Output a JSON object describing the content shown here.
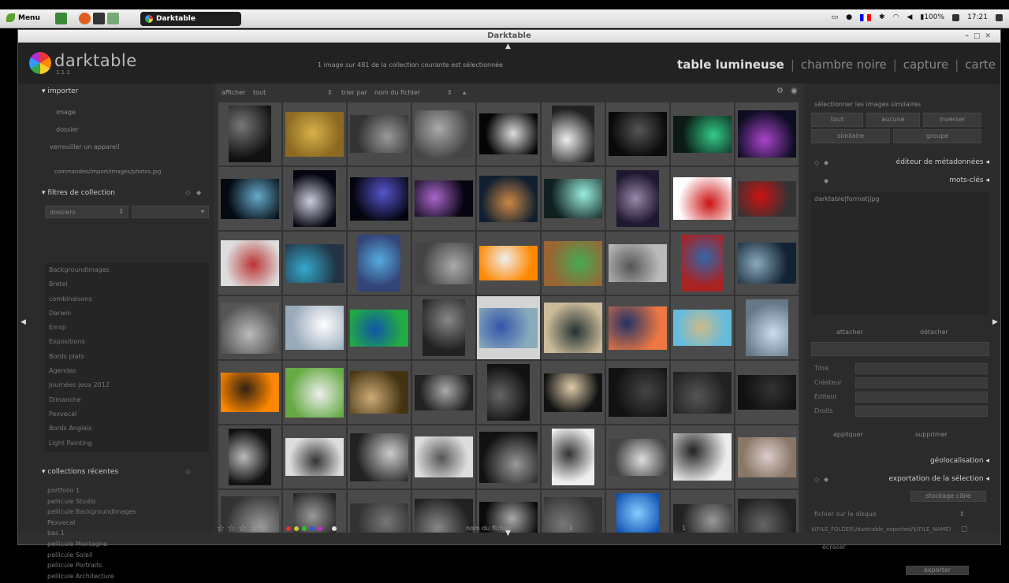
{
  "taskbar": {
    "menu_label": "Menu",
    "task_title": "Darktable",
    "battery": "100%",
    "clock": "17:21"
  },
  "window": {
    "title": "Darktable"
  },
  "app": {
    "logo_name": "darktable",
    "logo_version": "1.1.1",
    "collection_info": "1 image sur 481 de la collection courante est sélectionnée",
    "views": [
      "table lumineuse",
      "chambre noire",
      "capture",
      "carte"
    ],
    "active_view": "table lumineuse"
  },
  "left": {
    "importer": "importer",
    "import_items": [
      "image",
      "dossier",
      "verrouiller un appareil"
    ],
    "import_detail": "commandes/import/images/photos.jpg",
    "filters_header": "filtres de collection",
    "filter_select": "dossiers",
    "filter_list": [
      "BackgroundImages",
      "Bretel",
      "combinaisons",
      "Darwin",
      "Emoji",
      "Expositions",
      "Bords plats",
      "Agendas",
      "Journées jeux 2012",
      "Dimanche",
      "Pexvecal",
      "Bords Anglais",
      "Light Painting"
    ],
    "recent_header": "collections récentes",
    "recent_list": [
      "portfolio 1",
      "pellicule Studio",
      "pellicule BackgroundImages",
      "Pexvecal",
      "bas 1",
      "pellicule Montagne",
      "pellicule Soleil",
      "pellicule Portraits",
      "pellicule Architecture"
    ]
  },
  "center": {
    "show_label": "afficher",
    "show_value": "tout",
    "sort_label": "trier par",
    "sort_value": "nom du fichier",
    "bottom_select": "nom du fichier",
    "bottom_right": "1"
  },
  "right": {
    "top_label": "sélectionner les images similaires",
    "buttons_row1": [
      "tout",
      "aucune",
      "inverser"
    ],
    "buttons_row2": [
      "similaire",
      "groupe"
    ],
    "metadata_editor": "éditeur de métadonnées",
    "tags": "mots-clés",
    "tag_entry": "darktable|format|jpg",
    "attach": "attacher",
    "detach": "détacher",
    "fields": [
      "Titre",
      "Créateur",
      "Éditeur",
      "Droits"
    ],
    "apply": "appliquer",
    "delete": "supprimer",
    "geolocation": "géolocalisation",
    "export": "exportation de la sélection",
    "storage": "fichier sur le disque",
    "storage_button": "stockage cible",
    "path": "$(FILE_FOLDER)/darktable_exported/$(FILE_NAME)",
    "overwrite": "écraser",
    "export_button": "exporter"
  },
  "grid": {
    "selected_index": 31
  },
  "colors": {
    "selected_bg": "#d4d4d4",
    "thumb_bg": "#4a4a4a",
    "bg": "#333333"
  }
}
